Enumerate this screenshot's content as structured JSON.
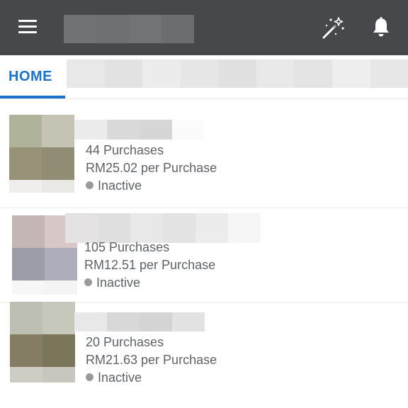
{
  "header": {
    "menu_icon": "hamburger-menu-icon",
    "wand_icon": "magic-wand-icon",
    "bell_icon": "notification-bell-icon",
    "title_redacted": true,
    "background": "#46484c"
  },
  "tabs": {
    "active_label": "HOME",
    "accent_color": "#1a73c8",
    "other_tabs_redacted": true
  },
  "products": [
    {
      "name_redacted": true,
      "purchases": "44 Purchases",
      "price": "RM25.02 per Purchase",
      "status": "Inactive",
      "status_color": "#9a9a9a"
    },
    {
      "name_redacted": true,
      "purchases": "105 Purchases",
      "price": "RM12.51 per Purchase",
      "status": "Inactive",
      "status_color": "#9a9a9a"
    },
    {
      "name_redacted": true,
      "purchases": "20 Purchases",
      "price": "RM21.63 per Purchase",
      "status": "Inactive",
      "status_color": "#9a9a9a"
    }
  ]
}
